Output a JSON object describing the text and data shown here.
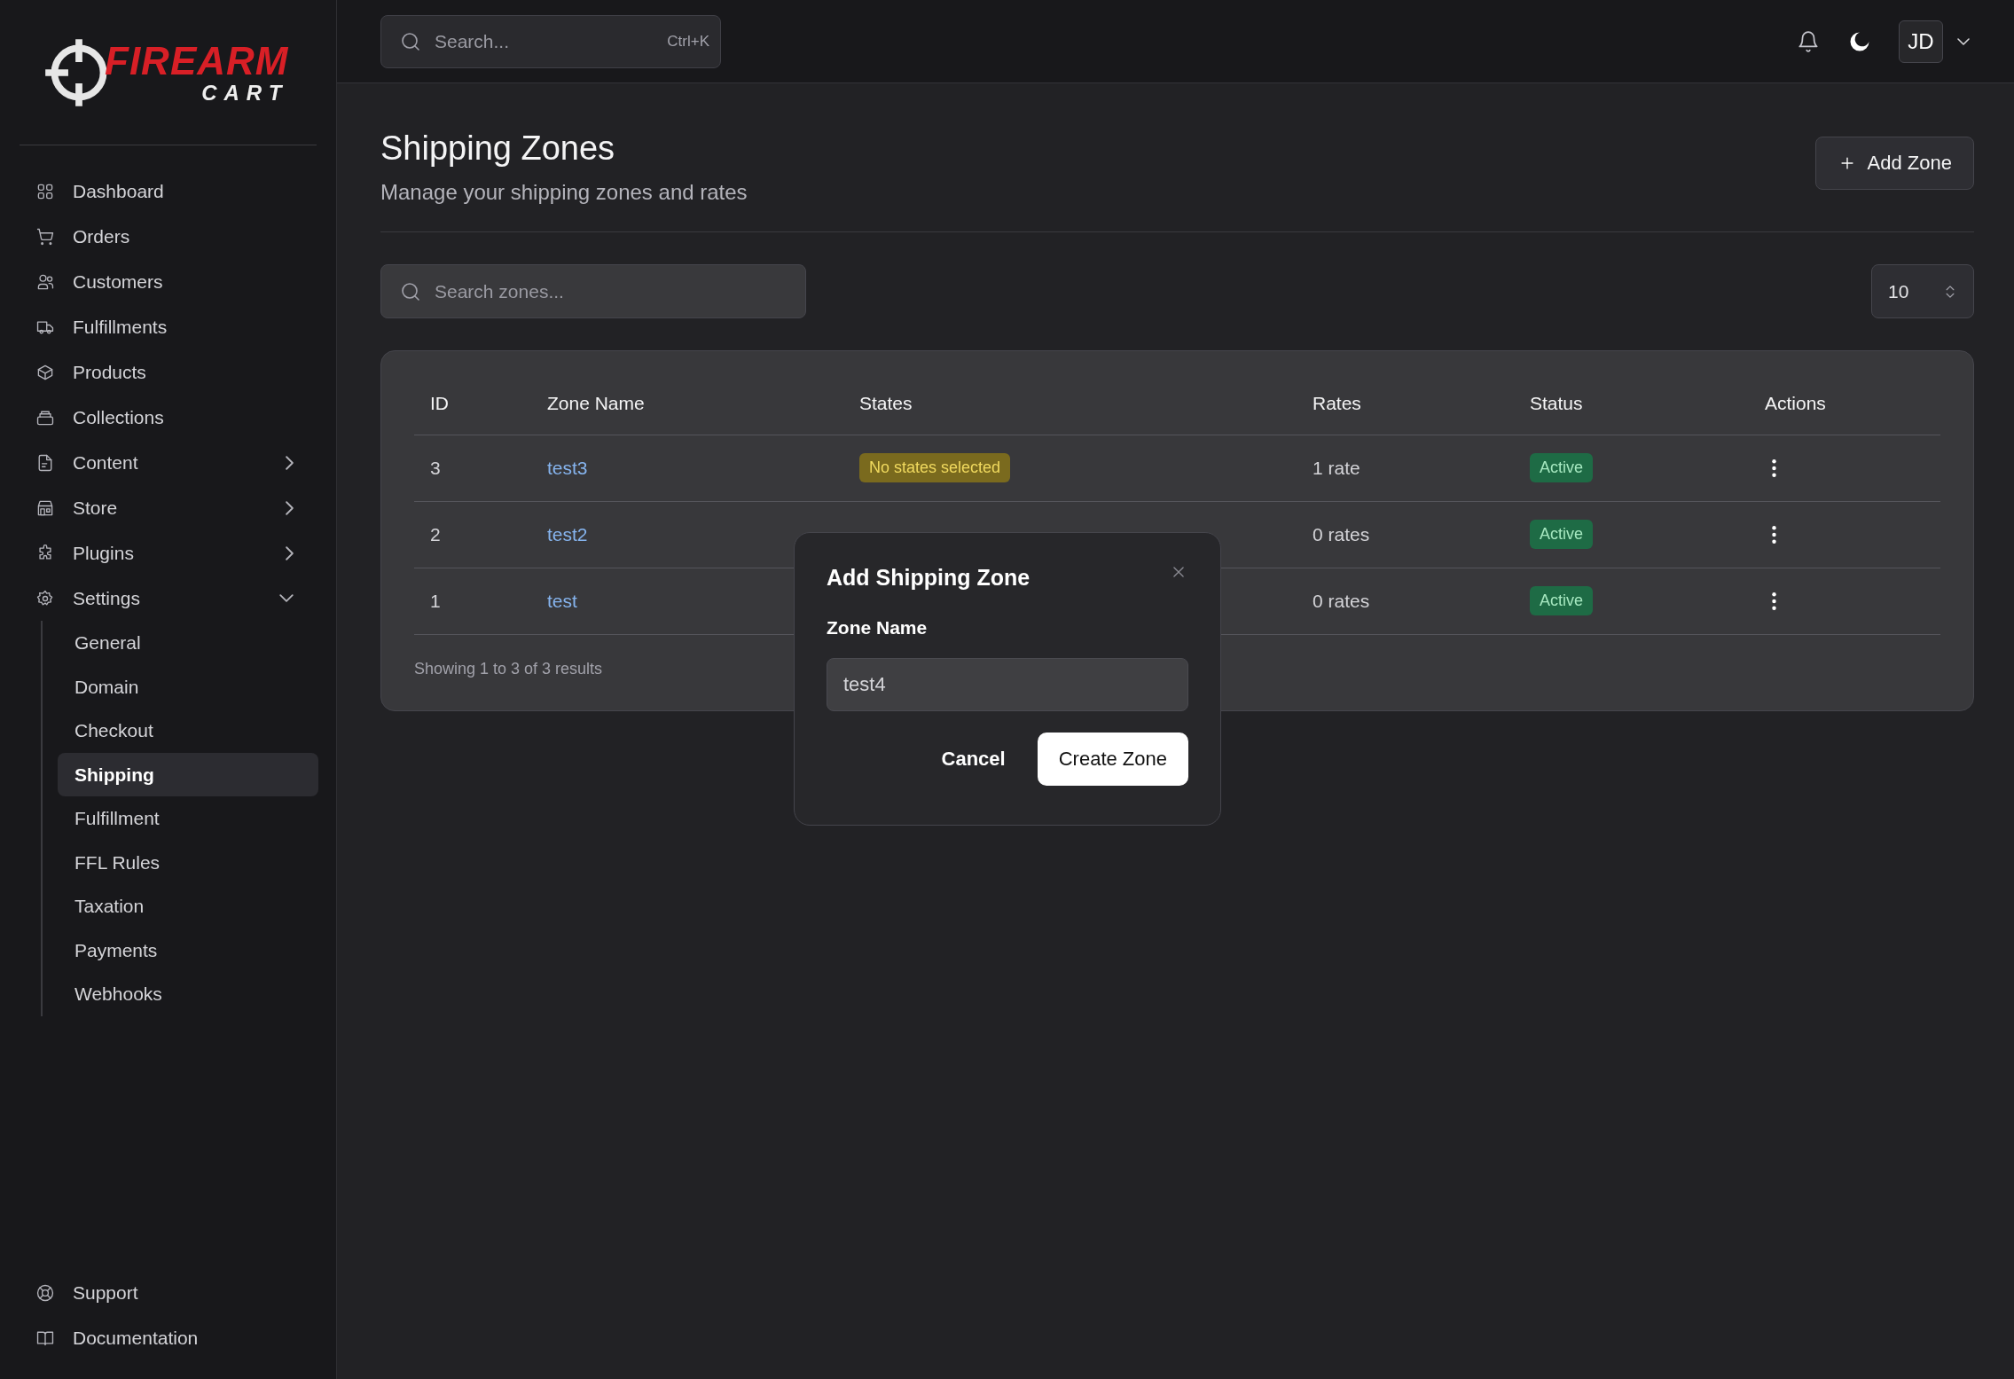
{
  "sidebar": {
    "logo": {
      "brand": "FIREARM",
      "sub": "CART"
    },
    "items": [
      {
        "label": "Dashboard"
      },
      {
        "label": "Orders"
      },
      {
        "label": "Customers"
      },
      {
        "label": "Fulfillments"
      },
      {
        "label": "Products"
      },
      {
        "label": "Collections"
      },
      {
        "label": "Content",
        "expanded": false
      },
      {
        "label": "Store",
        "expanded": false
      },
      {
        "label": "Plugins",
        "expanded": false
      },
      {
        "label": "Settings",
        "expanded": true,
        "children": [
          {
            "label": "General",
            "selected": false
          },
          {
            "label": "Domain",
            "selected": false
          },
          {
            "label": "Checkout",
            "selected": false
          },
          {
            "label": "Shipping",
            "selected": true
          },
          {
            "label": "Fulfillment",
            "selected": false
          },
          {
            "label": "FFL Rules",
            "selected": false
          },
          {
            "label": "Taxation",
            "selected": false
          },
          {
            "label": "Payments",
            "selected": false
          },
          {
            "label": "Webhooks",
            "selected": false
          }
        ]
      }
    ],
    "footer": [
      {
        "label": "Support"
      },
      {
        "label": "Documentation"
      }
    ]
  },
  "topbar": {
    "search": {
      "placeholder": "Search...",
      "shortcut": "Ctrl+K"
    },
    "avatar": "JD"
  },
  "page": {
    "title": "Shipping Zones",
    "subtitle": "Manage your shipping zones and rates",
    "add_button": "Add Zone",
    "search": {
      "placeholder": "Search zones..."
    },
    "page_size": "10"
  },
  "table": {
    "columns": [
      "ID",
      "Zone Name",
      "States",
      "Rates",
      "Status",
      "Actions"
    ],
    "rows": [
      {
        "id": "3",
        "name": "test3",
        "states": "No states selected",
        "rates": "1 rate",
        "status": "Active"
      },
      {
        "id": "2",
        "name": "test2",
        "rates": "0 rates",
        "status": "Active"
      },
      {
        "id": "1",
        "name": "test",
        "rates": "0 rates",
        "status": "Active"
      }
    ],
    "footer": "Showing 1 to 3 of 3 results"
  },
  "modal": {
    "title": "Add Shipping Zone",
    "field_label": "Zone Name",
    "value": "test4",
    "cancel": "Cancel",
    "submit": "Create Zone"
  }
}
